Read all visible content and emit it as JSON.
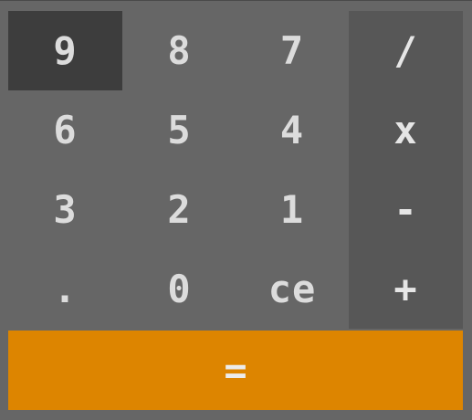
{
  "number_keys": [
    "9",
    "8",
    "7",
    "6",
    "5",
    "4",
    "3",
    "2",
    "1",
    ".",
    "0",
    "ce"
  ],
  "operator_keys": [
    "/",
    "x",
    "-",
    "+"
  ],
  "equals_label": "=",
  "active_key": "9",
  "colors": {
    "background": "#666666",
    "operator_column": "#575757",
    "active_key": "#3d3d3d",
    "equals_bar": "#dd8500",
    "key_text": "#dcdcdc"
  }
}
